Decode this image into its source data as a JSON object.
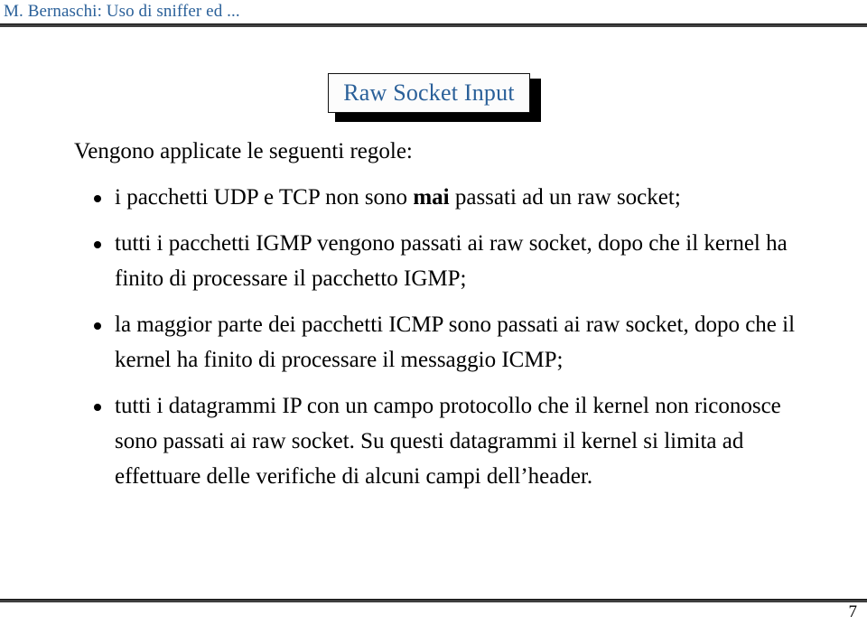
{
  "header": {
    "title": "M. Bernaschi: Uso di sniffer ed ...",
    "color": "#2a6099"
  },
  "slide": {
    "title": "Raw Socket Input",
    "title_color": "#2a6099",
    "intro": "Vengono applicate le seguenti regole:",
    "bullets": [
      {
        "pre": "i pacchetti UDP e TCP non sono ",
        "emphasis": "mai",
        "post": " passati ad un raw socket;"
      },
      {
        "pre": "tutti i pacchetti IGMP vengono passati ai raw socket, dopo che il kernel ha finito di processare il pacchetto IGMP;",
        "emphasis": "",
        "post": ""
      },
      {
        "pre": "la maggior parte dei pacchetti ICMP sono passati ai raw socket, dopo che il kernel ha finito di processare il messaggio ICMP;",
        "emphasis": "",
        "post": ""
      },
      {
        "pre": "tutti i datagrammi IP con un campo protocollo che il kernel non riconosce sono passati ai raw socket. Su questi datagrammi il kernel si limita ad effettuare delle verifiche di alcuni campi dell’header.",
        "emphasis": "",
        "post": ""
      }
    ]
  },
  "footer": {
    "page_number": "7"
  }
}
